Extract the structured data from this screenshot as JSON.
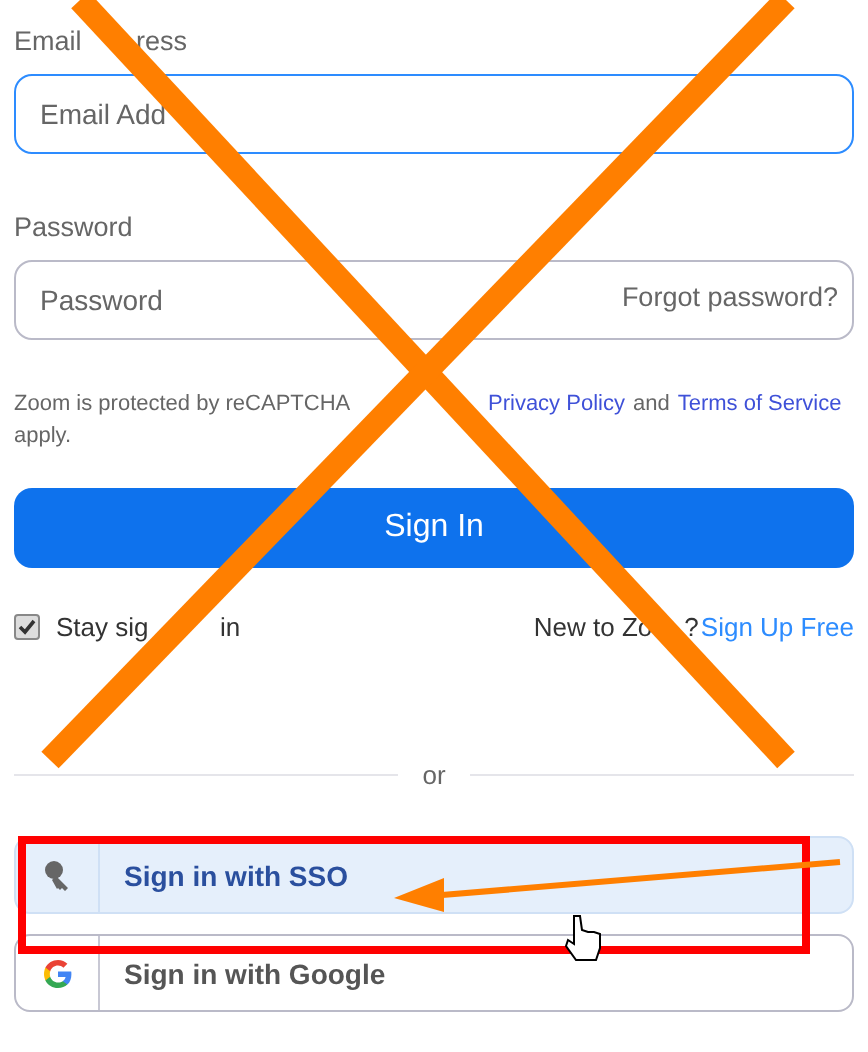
{
  "email": {
    "label_parts": [
      "Email",
      "ress"
    ],
    "placeholder": "Email Add",
    "focused": true
  },
  "password": {
    "label": "Password",
    "placeholder": "Password",
    "forgot_link": "Forgot password?"
  },
  "recaptcha": {
    "lead": "Zoom is protected by reCAPTCHA",
    "privacy_link": "Privacy Policy",
    "joiner": "and",
    "terms_link": "Terms of Service",
    "tail": "apply."
  },
  "sign_in_button": "Sign In",
  "stay_signed_in": {
    "label_parts": [
      "Stay sig",
      "in"
    ],
    "checked": true
  },
  "signup": {
    "text_parts": [
      "New to Zo",
      "?"
    ],
    "link": "Sign Up Free"
  },
  "divider": "or",
  "alt_sign_in": [
    {
      "kind": "sso",
      "label": "Sign in with SSO",
      "highlighted": true
    },
    {
      "kind": "google",
      "label": "Sign in with Google",
      "highlighted": false
    }
  ]
}
